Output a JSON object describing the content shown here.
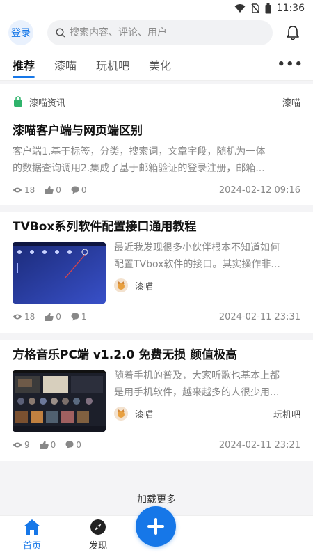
{
  "status_bar": {
    "time": "11:36"
  },
  "header": {
    "login_label": "登录",
    "search_placeholder": "搜索内容、评论、用户"
  },
  "tabs": [
    {
      "label": "推荐",
      "active": true
    },
    {
      "label": "漆喵"
    },
    {
      "label": "玩机吧"
    },
    {
      "label": "美化"
    }
  ],
  "more_label": "•••",
  "feed": [
    {
      "source": "漆喵资讯",
      "source_tag": "漆喵",
      "title": "漆喵客户端与网页端区别",
      "excerpt_line1": "客户端1.基于标签，分类，搜索词，文章字段，随机为一体",
      "excerpt_line2": "的数据查询调用2.集成了基于邮箱验证的登录注册，邮箱...",
      "views": "18",
      "likes": "0",
      "comments": "0",
      "date": "2024-02-12 09:16"
    },
    {
      "title": "TVBox系列软件配置接口通用教程",
      "excerpt_line1": "最近我发现很多小伙伴根本不知道如何",
      "excerpt_line2": "配置TVbox软件的接口。其实操作非...",
      "author": "漆喵",
      "views": "18",
      "likes": "0",
      "comments": "1",
      "date": "2024-02-11 23:31"
    },
    {
      "title": "方格音乐PC端 v1.2.0 免费无损 颜值极高",
      "excerpt_line1": "随着手机的普及，大家听歌也基本上都",
      "excerpt_line2": "是用手机软件，越来越多的人很少用...",
      "author": "漆喵",
      "tag": "玩机吧",
      "views": "9",
      "likes": "0",
      "comments": "0",
      "date": "2024-02-11 23:21"
    }
  ],
  "load_more": "加载更多",
  "bottom_nav": {
    "home": "首页",
    "discover": "发现"
  },
  "colors": {
    "accent": "#1677e8"
  }
}
